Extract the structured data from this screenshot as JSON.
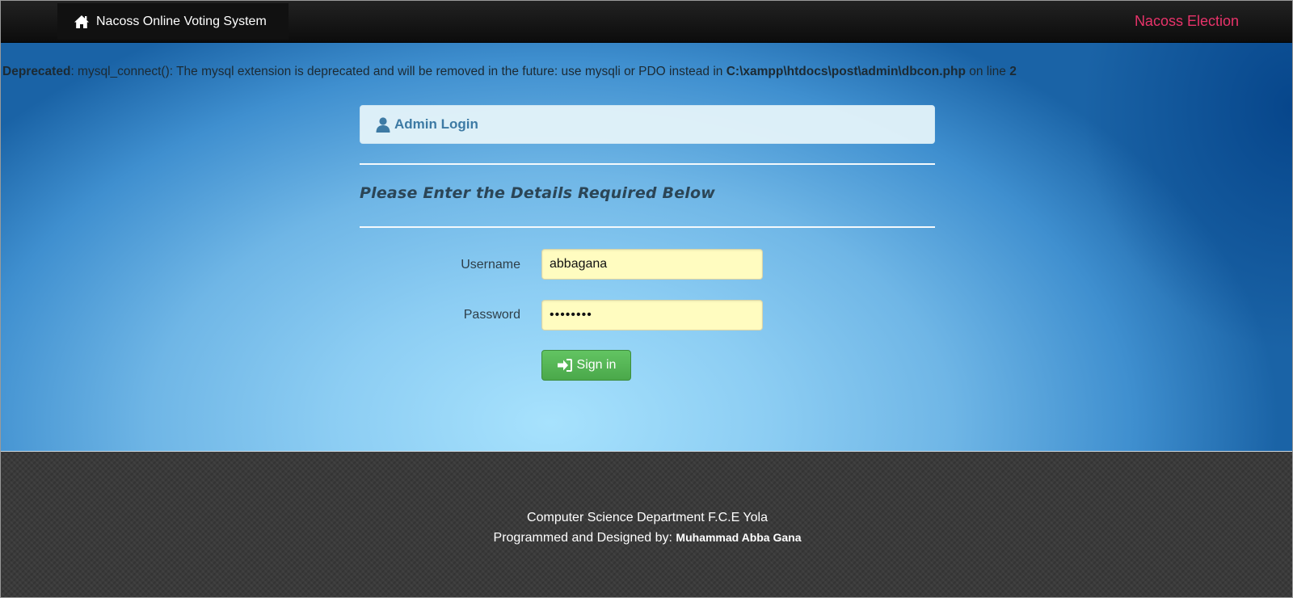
{
  "navbar": {
    "brand_label": "Nacoss Online Voting System",
    "brand_icon": "home-icon",
    "right_label": "Nacoss Election",
    "right_color": "#e8336a"
  },
  "warning": {
    "level": "Deprecated",
    "message": ": mysql_connect(): The mysql extension is deprecated and will be removed in the future: use mysqli or PDO instead in ",
    "file": "C:\\xampp\\htdocs\\post\\admin\\dbcon.php",
    "line_prefix": " on line ",
    "line": "2"
  },
  "login": {
    "panel_title": "Admin Login",
    "panel_icon": "user-icon",
    "subtitle": "Please Enter the Details Required Below",
    "username_label": "Username",
    "username_value": "abbagana",
    "password_label": "Password",
    "password_value": "••••••••",
    "signin_label": "Sign in",
    "signin_icon": "sign-in-icon",
    "button_color": "#5cb85c"
  },
  "footer": {
    "line1": "Computer Science Department F.C.E Yola",
    "line2_prefix": "Programmed and Designed by: ",
    "author": "Muhammad Abba Gana"
  }
}
